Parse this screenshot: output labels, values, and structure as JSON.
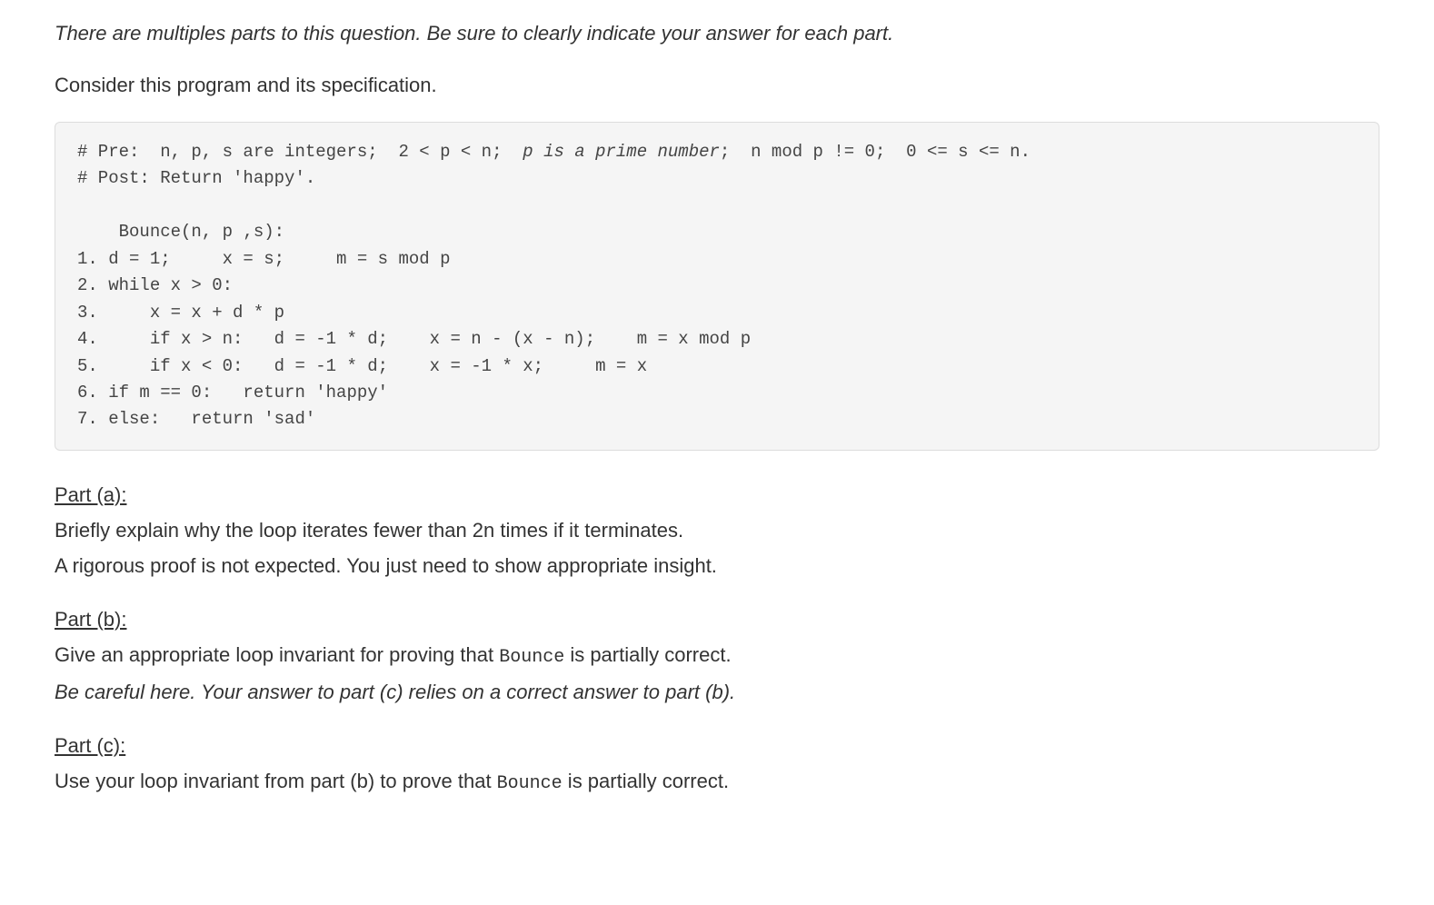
{
  "intro": {
    "italic_line": "There are multiples parts to this question. Be sure to clearly indicate your answer for each part.",
    "consider_line": "Consider this program and its specification."
  },
  "code": {
    "pre_prefix": "# Pre:  n, p, s are integers;  2 < p < n;  ",
    "pre_italic": "p is a prime number",
    "pre_suffix": ";  n mod p != 0;  0 <= s <= n.",
    "post_line": "# Post: Return 'happy'.",
    "blank1": "",
    "func_sig": "    Bounce(n, p ,s):",
    "line1": "1. d = 1;     x = s;     m = s mod p",
    "line2": "2. while x > 0:",
    "line3": "3.     x = x + d * p",
    "line4": "4.     if x > n:   d = -1 * d;    x = n - (x - n);    m = x mod p",
    "line5": "5.     if x < 0:   d = -1 * d;    x = -1 * x;     m = x",
    "line6": "6. if m == 0:   return 'happy'",
    "line7": "7. else:   return 'sad'"
  },
  "parts": {
    "a": {
      "heading": "Part (a):",
      "line1": "Briefly explain why the loop iterates fewer than 2n times if it terminates.",
      "line2": "A rigorous proof is not expected. You just need to show appropriate insight."
    },
    "b": {
      "heading": "Part (b):",
      "line1_pre": "Give an appropriate loop invariant for proving that ",
      "line1_code": "Bounce",
      "line1_post": " is partially correct.",
      "line2": "Be careful here. Your answer to part (c) relies on a correct answer to part (b)."
    },
    "c": {
      "heading": "Part (c):",
      "line1_pre": "Use your loop invariant from part (b) to prove that ",
      "line1_code": "Bounce",
      "line1_post": " is partially correct."
    }
  }
}
